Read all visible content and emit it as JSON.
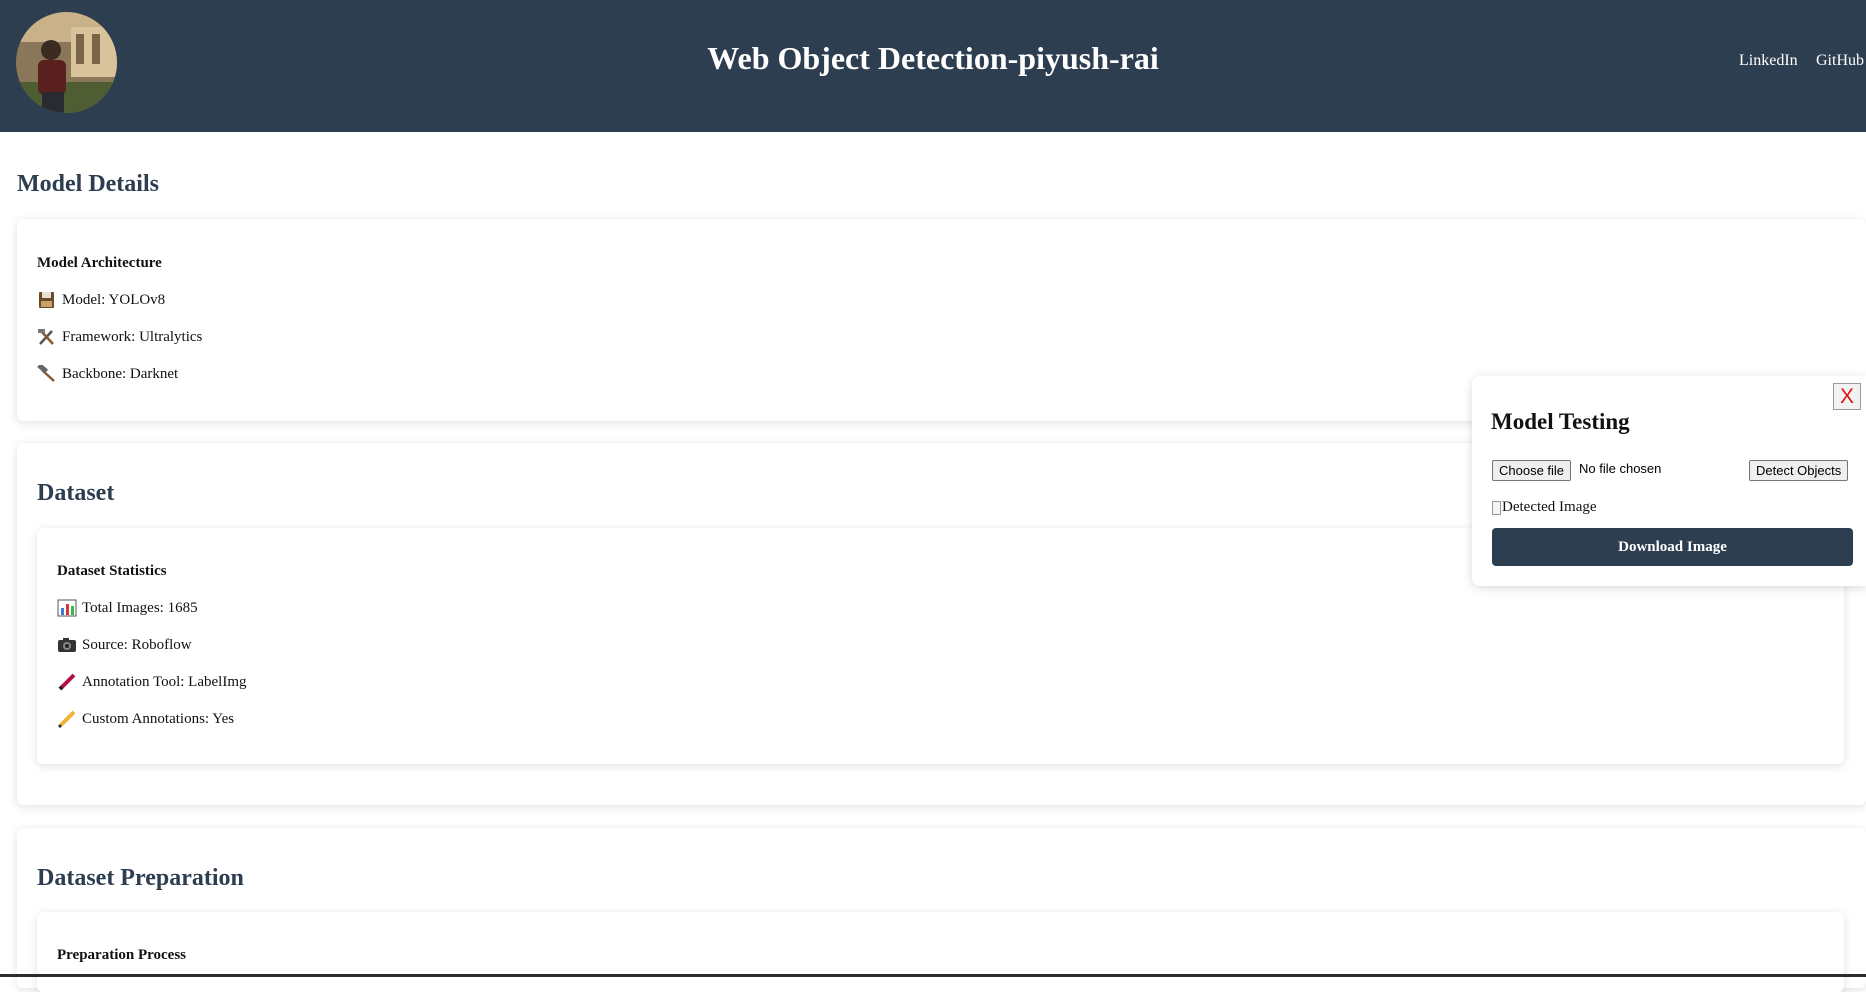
{
  "header": {
    "title": "Web Object Detection-piyush-rai",
    "nav": [
      {
        "label": "LinkedIn"
      },
      {
        "label": "GitHub"
      }
    ]
  },
  "model_details": {
    "title": "Model Details",
    "heading": "Model Architecture",
    "items": [
      {
        "icon": "floppy-disk-icon",
        "label": "Model: YOLOv8"
      },
      {
        "icon": "hammer-and-wrench-icon",
        "label": "Framework: Ultralytics"
      },
      {
        "icon": "hammer-icon",
        "label": "Backbone: Darknet"
      }
    ]
  },
  "dataset": {
    "title": "Dataset",
    "heading": "Dataset Statistics",
    "items": [
      {
        "icon": "bar-chart-icon",
        "label": "Total Images: 1685"
      },
      {
        "icon": "camera-icon",
        "label": "Source: Roboflow"
      },
      {
        "icon": "pen-icon",
        "label": "Annotation Tool: LabelImg"
      },
      {
        "icon": "pencil-icon",
        "label": "Custom Annotations: Yes"
      }
    ]
  },
  "dataset_preparation": {
    "title": "Dataset Preparation",
    "heading": "Preparation Process"
  },
  "model_testing": {
    "title": "Model Testing",
    "close_label": "X",
    "choose_file_label": "Choose file",
    "file_status": "No file chosen",
    "detect_label": "Detect Objects",
    "image_alt": "Detected Image",
    "download_label": "Download Image"
  },
  "colors": {
    "header_bg": "#2e3e51",
    "accent": "#2e3e51",
    "close_x": "#dd1111"
  }
}
